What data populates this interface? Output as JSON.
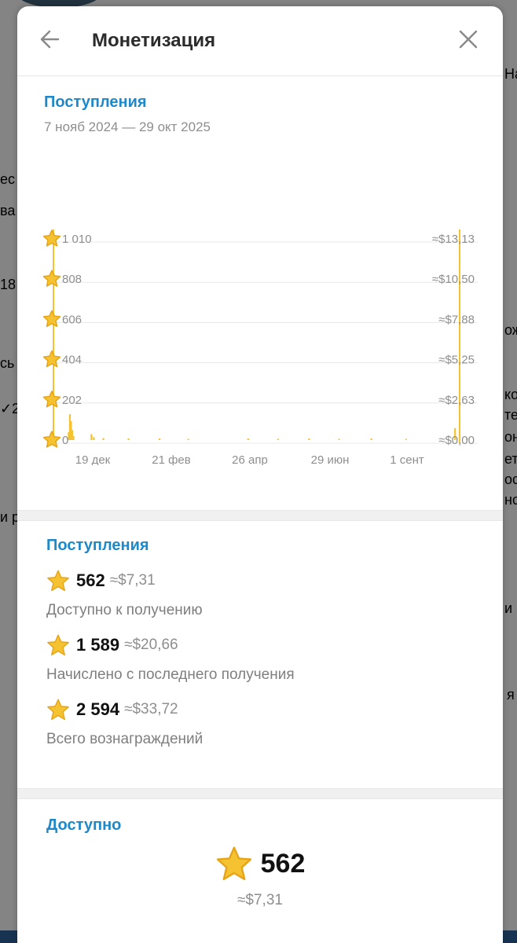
{
  "background": {
    "left_fragments": [
      "ес",
      "ва",
      "18",
      "сь",
      "✓2",
      "и р"
    ],
    "right_fragments": [
      "На",
      "ож",
      "ко",
      "те",
      "он",
      "ет",
      "ос",
      "нс",
      "и",
      "я"
    ]
  },
  "header": {
    "title": "Монетизация"
  },
  "revenue_chart": {
    "title": "Поступления",
    "date_range": "7 нояб 2024 — 29 окт 2025",
    "y_labels": [
      "1 010",
      "808",
      "606",
      "404",
      "202",
      "0"
    ],
    "usd_labels": [
      "≈$13,13",
      "≈$10,50",
      "≈$7,88",
      "≈$5,25",
      "≈$2,63",
      "≈$0,00"
    ],
    "x_labels": [
      "19 дек",
      "21 фев",
      "26 апр",
      "29 июн",
      "1 сент"
    ]
  },
  "chart_data": {
    "type": "bar",
    "title": "Поступления",
    "xlabel": "",
    "ylabel": "",
    "ylim": [
      0,
      1010
    ],
    "y_ticks": [
      0,
      202,
      404,
      606,
      808,
      1010
    ],
    "usd_ticks": [
      "≈$0,00",
      "≈$2,63",
      "≈$5,25",
      "≈$7,88",
      "≈$10,50",
      "≈$13,13"
    ],
    "x_ticks": [
      "19 дек",
      "21 фев",
      "26 апр",
      "29 июн",
      "1 сент"
    ],
    "start": "2024-11-07",
    "end": "2025-10-29",
    "points": [
      {
        "date": "2024-11-21",
        "value": 40
      },
      {
        "date": "2024-11-22",
        "value": 130
      },
      {
        "date": "2024-11-23",
        "value": 95
      },
      {
        "date": "2024-11-24",
        "value": 50
      },
      {
        "date": "2024-11-25",
        "value": 20
      },
      {
        "date": "2024-12-10",
        "value": 30
      },
      {
        "date": "2024-12-12",
        "value": 15
      },
      {
        "date": "2024-12-20",
        "value": 10
      },
      {
        "date": "2025-01-10",
        "value": 8
      },
      {
        "date": "2025-02-05",
        "value": 8
      },
      {
        "date": "2025-03-01",
        "value": 6
      },
      {
        "date": "2025-04-20",
        "value": 8
      },
      {
        "date": "2025-05-15",
        "value": 6
      },
      {
        "date": "2025-06-10",
        "value": 8
      },
      {
        "date": "2025-07-05",
        "value": 6
      },
      {
        "date": "2025-08-01",
        "value": 8
      },
      {
        "date": "2025-08-30",
        "value": 6
      },
      {
        "date": "2025-10-10",
        "value": 60
      },
      {
        "date": "2025-10-20",
        "value": 10
      }
    ],
    "grid": true,
    "colors": {
      "bars": "#f5c332",
      "grid": "#e8e8e8"
    }
  },
  "stats": {
    "title": "Поступления",
    "items": [
      {
        "amount": "562",
        "usd": "≈$7,31",
        "label": "Доступно к получению"
      },
      {
        "amount": "1 589",
        "usd": "≈$20,66",
        "label": "Начислено с последнего получения"
      },
      {
        "amount": "2 594",
        "usd": "≈$33,72",
        "label": "Всего вознаграждений"
      }
    ]
  },
  "available": {
    "title": "Доступно",
    "amount": "562",
    "usd": "≈$7,31"
  },
  "colors": {
    "accent": "#1e88c9",
    "star": "#f5c332",
    "star_outline": "#e8a417"
  }
}
